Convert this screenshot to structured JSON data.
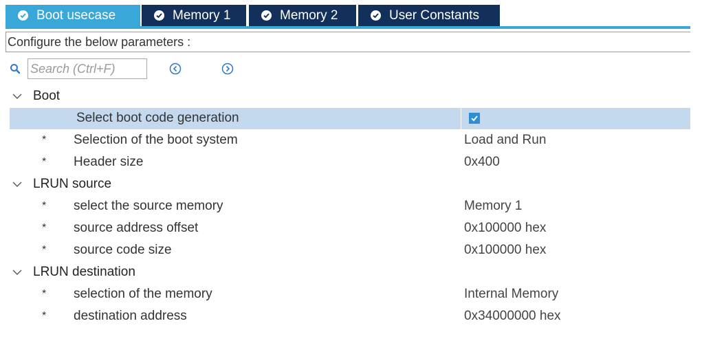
{
  "tabs": [
    {
      "label": "Boot usecase",
      "active": true
    },
    {
      "label": "Memory 1",
      "active": false
    },
    {
      "label": "Memory 2",
      "active": false
    },
    {
      "label": "User Constants",
      "active": false
    }
  ],
  "configure_text": "Configure the below parameters :",
  "search": {
    "placeholder": "Search (Ctrl+F)"
  },
  "groups": {
    "boot": {
      "title": "Boot",
      "select_boot_code_generation": {
        "label": "Select boot code generation",
        "checked": true
      },
      "rows": [
        {
          "bullet": "*",
          "label": "Selection of the boot system",
          "value": "Load and Run"
        },
        {
          "bullet": "*",
          "label": "Header size",
          "value": "0x400"
        }
      ]
    },
    "lrun_source": {
      "title": "LRUN source",
      "rows": [
        {
          "bullet": "*",
          "label": "select the source memory",
          "value": "Memory 1"
        },
        {
          "bullet": "*",
          "label": "source address offset",
          "value": "0x100000 hex"
        },
        {
          "bullet": "*",
          "label": "source code size",
          "value": "0x100000 hex"
        }
      ]
    },
    "lrun_destination": {
      "title": "LRUN destination",
      "rows": [
        {
          "bullet": "*",
          "label": "selection of the memory",
          "value": "Internal Memory"
        },
        {
          "bullet": "*",
          "label": "destination address",
          "value": "0x34000000 hex"
        }
      ]
    }
  },
  "colors": {
    "tab_active": "#3aa7d9",
    "tab_inactive": "#12305a",
    "row_selected": "#c5d9ee",
    "checkbox": "#2e8fd0"
  }
}
